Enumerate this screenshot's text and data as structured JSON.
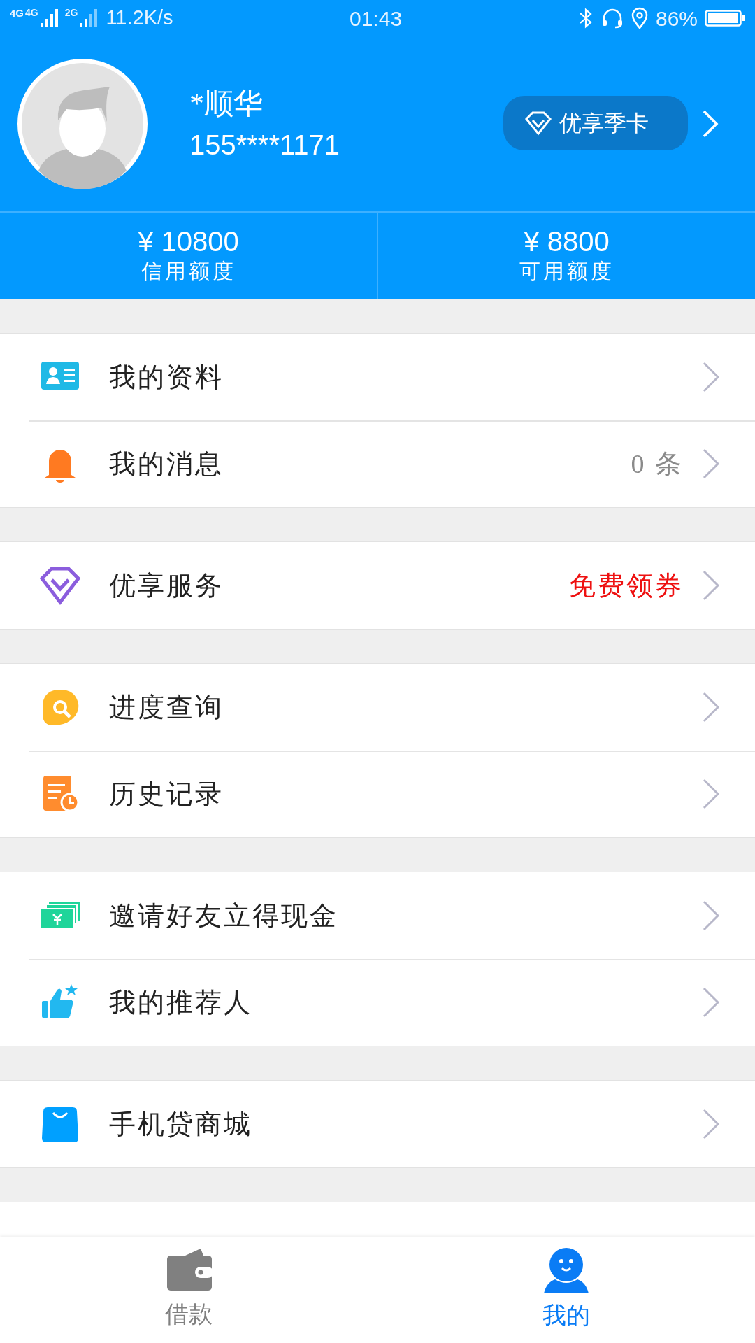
{
  "status_bar": {
    "network_1": "4G",
    "network_2": "4G",
    "network_3": "2G",
    "speed": "11.2K/s",
    "time": "01:43",
    "battery": "86%"
  },
  "profile": {
    "name": "*顺华",
    "phone": "155****1171",
    "card_button": "优享季卡"
  },
  "credit": [
    {
      "amount": "¥ 10800",
      "label": "信用额度"
    },
    {
      "amount": "¥ 8800",
      "label": "可用额度"
    }
  ],
  "menu_groups": [
    {
      "items": [
        {
          "label": "我的资料"
        },
        {
          "label": "我的消息",
          "trailing": {
            "text": "0 条",
            "kind": "count"
          }
        }
      ]
    },
    {
      "items": [
        {
          "label": "优享服务",
          "trailing": {
            "text": "免费领券",
            "kind": "promo"
          }
        }
      ]
    },
    {
      "items": [
        {
          "label": "进度查询"
        },
        {
          "label": "历史记录"
        }
      ]
    },
    {
      "items": [
        {
          "label": "邀请好友立得现金"
        },
        {
          "label": "我的推荐人"
        }
      ]
    },
    {
      "items": [
        {
          "label": "手机贷商城"
        }
      ]
    }
  ],
  "tab_bar": [
    {
      "label": "借款",
      "selected": false
    },
    {
      "label": "我的",
      "selected": true
    }
  ]
}
